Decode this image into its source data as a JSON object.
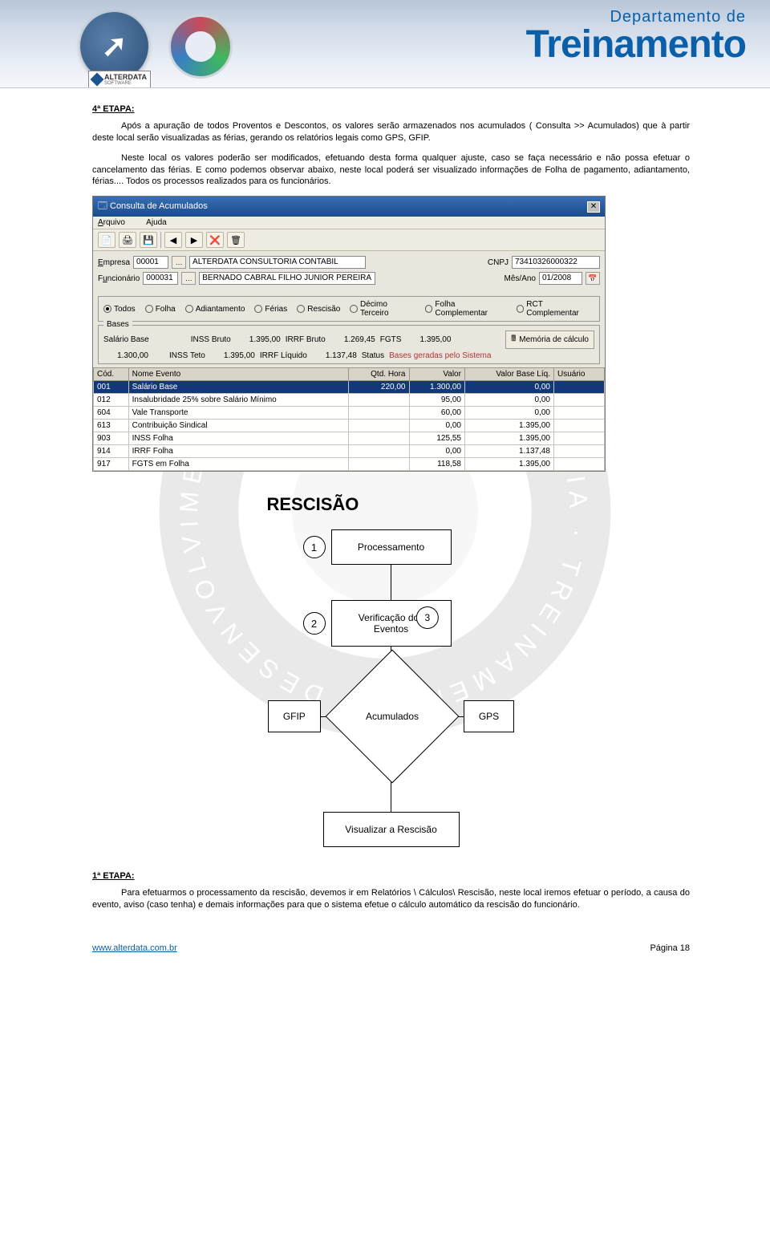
{
  "banner": {
    "dep": "Departamento de",
    "title": "Treinamento",
    "logo_text": "ALTERDATA",
    "logo_sub": "SOFTWARE"
  },
  "doc": {
    "h_etapa4": "4ª ETAPA:",
    "p1": "Após a apuração de todos Proventos e Descontos, os valores serão armazenados nos acumulados ( Consulta >> Acumulados) que à partir deste local serão visualizadas as férias, gerando os relatórios legais como GPS, GFIP.",
    "p2": "Neste local os valores poderão ser modificados, efetuando desta forma qualquer ajuste, caso se faça necessário e não possa efetuar o cancelamento das férias. E como podemos observar abaixo, neste local poderá ser visualizado informações de Folha de pagamento, adiantamento, férias.... Todos os processos realizados para os funcionários.",
    "h_etapa1": "1ª ETAPA:",
    "p3": "Para efetuarmos o processamento da rescisão, devemos ir em Relatórios \\ Cálculos\\ Rescisão, neste local iremos efetuar o período, a causa do evento, aviso (caso tenha) e demais informações para que o sistema efetue o cálculo automático da rescisão do funcionário."
  },
  "app": {
    "title": "Consulta de Acumulados",
    "menu": {
      "arquivo": "Arquivo",
      "ajuda": "Ajuda"
    },
    "toolbar_icons": [
      "📄",
      "🖨",
      "💾",
      "|",
      "◀",
      "▶",
      "❌",
      "🗑"
    ],
    "empresa_label": "Empresa",
    "empresa_cod": "00001",
    "empresa_nome": "ALTERDATA CONSULTORIA CONTABIL",
    "cnpj_label": "CNPJ",
    "cnpj": "73410326000322",
    "func_label": "Funcionário",
    "func_cod": "000031",
    "func_nome": "BERNADO CABRAL FILHO JUNIOR PEREIRA",
    "mesago_label": "Mês/Ano",
    "mesago": "01/2008",
    "radios": [
      {
        "key": "Todos",
        "label": "Todos",
        "u": "T",
        "sel": true
      },
      {
        "key": "Folha",
        "label": "Folha",
        "u": "o",
        "sel": false
      },
      {
        "key": "Adiantamento",
        "label": "Adiantamento",
        "u": "A",
        "sel": false
      },
      {
        "key": "Ferias",
        "label": "Férias",
        "u": "F",
        "sel": false
      },
      {
        "key": "Rescisao",
        "label": "Rescisão",
        "u": "R",
        "sel": false
      },
      {
        "key": "DecimoTerceiro",
        "label": "Décimo Terceiro",
        "u": "D",
        "sel": false
      },
      {
        "key": "FolhaComplementar",
        "label": "Folha Complementar",
        "u": "o",
        "sel": false
      },
      {
        "key": "RCTComplementar",
        "label": "RCT Complementar",
        "u": "o",
        "sel": false
      }
    ],
    "bases_legend": "Bases",
    "bases": {
      "salario_base_lbl": "Salário Base",
      "salario_base_val": "1.300,00",
      "inss_bruto_lbl": "INSS Bruto",
      "inss_bruto_val": "1.395,00",
      "irrf_bruto_lbl": "IRRF Bruto",
      "irrf_bruto_val": "1.269,45",
      "fgts_lbl": "FGTS",
      "fgts_val": "1.395,00",
      "inss_teto_lbl": "INSS Teto",
      "inss_teto_val": "1.395,00",
      "irrf_liq_lbl": "IRRF Líquido",
      "irrf_liq_val": "1.137,48",
      "status_lbl": "Status",
      "status_val": "Bases geradas pelo Sistema",
      "mem_btn": "Memória de cálculo"
    },
    "columns": [
      "Cód.",
      "Nome Evento",
      "Qtd. Hora",
      "Valor",
      "Valor Base Líq.",
      "Usuário"
    ],
    "rows": [
      {
        "cod": "001",
        "nome": "Salário Base",
        "qtd": "220,00",
        "valor": "1.300,00",
        "base": "0,00",
        "usr": "",
        "sel": true
      },
      {
        "cod": "012",
        "nome": "Insalubridade 25% sobre Salário Mínimo",
        "qtd": "",
        "valor": "95,00",
        "base": "0,00",
        "usr": ""
      },
      {
        "cod": "604",
        "nome": "Vale Transporte",
        "qtd": "",
        "valor": "60,00",
        "base": "0,00",
        "usr": ""
      },
      {
        "cod": "613",
        "nome": "Contribuição Sindical",
        "qtd": "",
        "valor": "0,00",
        "base": "1.395,00",
        "usr": ""
      },
      {
        "cod": "903",
        "nome": "INSS Folha",
        "qtd": "",
        "valor": "125,55",
        "base": "1.395,00",
        "usr": ""
      },
      {
        "cod": "914",
        "nome": "IRRF Folha",
        "qtd": "",
        "valor": "0,00",
        "base": "1.137,48",
        "usr": ""
      },
      {
        "cod": "917",
        "nome": "FGTS em Folha",
        "qtd": "",
        "valor": "118,58",
        "base": "1.395,00",
        "usr": ""
      }
    ]
  },
  "flow": {
    "title": "RESCISÃO",
    "n1": "1",
    "b1": "Processamento",
    "n2": "2",
    "b2": "Verificação dos\nEventos",
    "n3": "3",
    "diamond": "Acumulados",
    "left": "GFIP",
    "right": "GPS",
    "b4": "Visualizar a Rescisão"
  },
  "footer": {
    "url": "www.alterdata.com.br",
    "page": "Página 18"
  }
}
